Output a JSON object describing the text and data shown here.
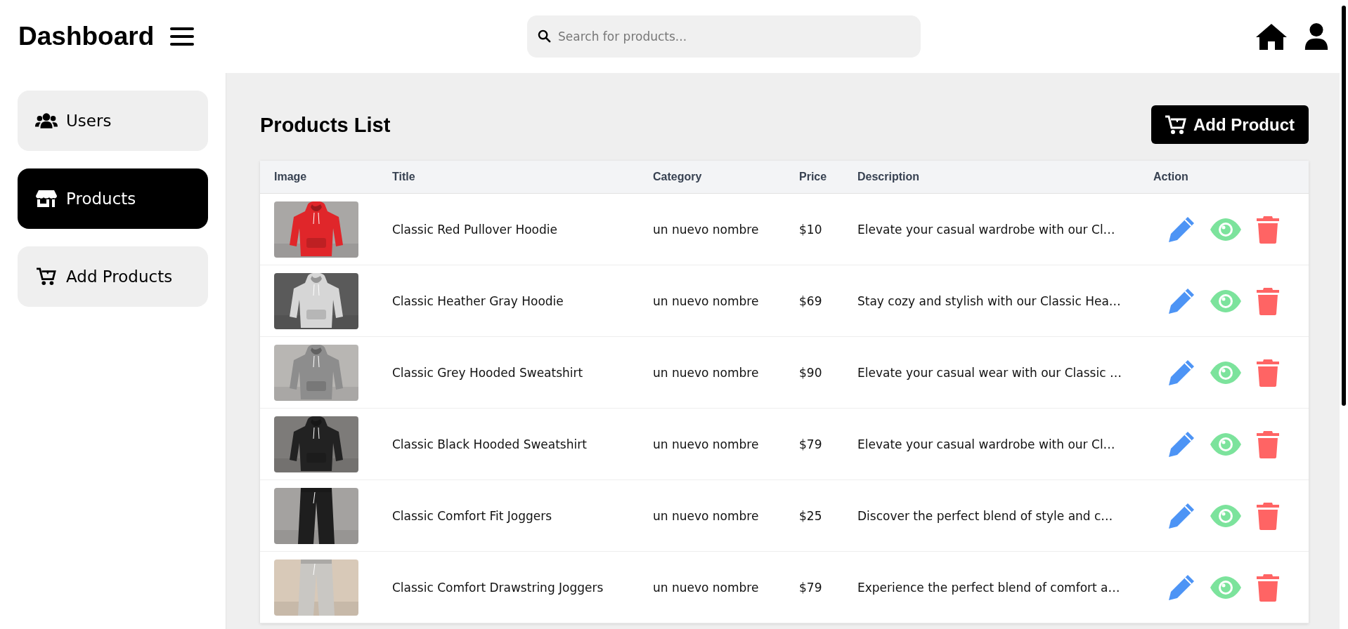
{
  "header": {
    "title": "Dashboard",
    "search": {
      "placeholder": "Search for products..."
    }
  },
  "sidebar": {
    "items": [
      {
        "label": "Users",
        "kind": "users",
        "selected": false
      },
      {
        "label": "Products",
        "kind": "store",
        "selected": true
      },
      {
        "label": "Add Products",
        "kind": "cart",
        "selected": false
      }
    ]
  },
  "main": {
    "heading": "Products List",
    "add_button": "Add Product",
    "table": {
      "columns": [
        "Image",
        "Title",
        "Category",
        "Price",
        "Description",
        "Action"
      ],
      "rows": [
        {
          "title": "Classic Red Pullover Hoodie",
          "category": "un nuevo nombre",
          "price": "$10",
          "description": "Elevate your casual wardrobe with our Cl…"
        },
        {
          "title": "Classic Heather Gray Hoodie",
          "category": "un nuevo nombre",
          "price": "$69",
          "description": "Stay cozy and stylish with our Classic Hea…"
        },
        {
          "title": "Classic Grey Hooded Sweatshirt",
          "category": "un nuevo nombre",
          "price": "$90",
          "description": "Elevate your casual wear with our Classic …"
        },
        {
          "title": "Classic Black Hooded Sweatshirt",
          "category": "un nuevo nombre",
          "price": "$79",
          "description": "Elevate your casual wardrobe with our Cl…"
        },
        {
          "title": "Classic Comfort Fit Joggers",
          "category": "un nuevo nombre",
          "price": "$25",
          "description": "Discover the perfect blend of style and c…"
        },
        {
          "title": "Classic Comfort Drawstring Joggers",
          "category": "un nuevo nombre",
          "price": "$79",
          "description": "Experience the perfect blend of comfort a…"
        }
      ]
    }
  }
}
